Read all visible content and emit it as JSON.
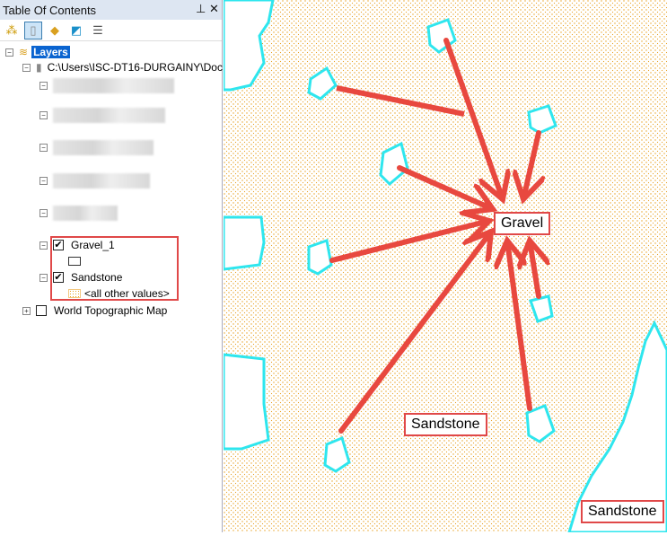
{
  "toc": {
    "title": "Table Of Contents",
    "pin": "📌",
    "close": "✕",
    "toolbar": [
      "list-by-drawing-order",
      "list-by-source",
      "list-by-visibility",
      "list-by-selection",
      "options"
    ],
    "root": "Layers",
    "source": "C:\\Users\\ISC-DT16-DURGAINY\\Doc",
    "layers": [
      {
        "name": "Gravel_1",
        "checked": true
      },
      {
        "name": "Sandstone",
        "checked": true,
        "legend": "<all other values>"
      },
      {
        "name": "World Topographic Map",
        "checked": false
      }
    ]
  },
  "map": {
    "labels": {
      "gravel": "Gravel",
      "sandstone1": "Sandstone",
      "sandstone2": "Sandstone"
    },
    "colors": {
      "arrow": "#e8483f",
      "polygon": "#2ee6ee",
      "dots": "#e8a020"
    }
  }
}
